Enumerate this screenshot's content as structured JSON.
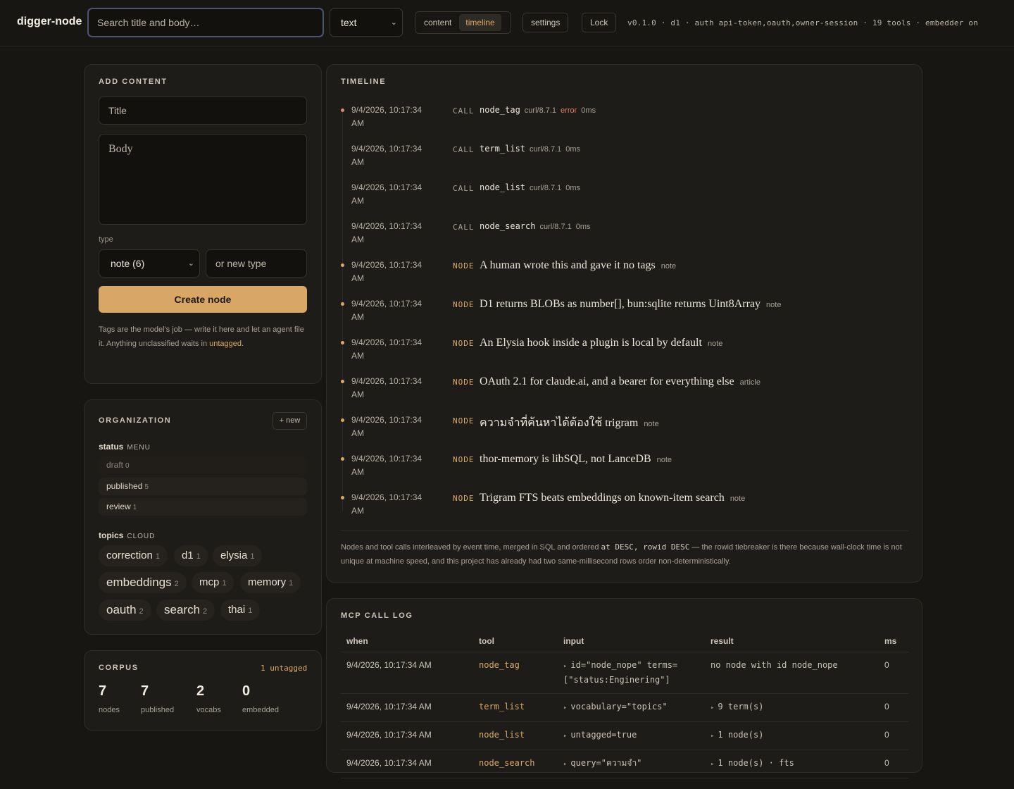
{
  "app": {
    "name": "digger-node",
    "search_placeholder": "Search title and body…",
    "search_mode": "text",
    "view_tabs": [
      "content",
      "timeline"
    ],
    "active_view": "timeline",
    "settings_label": "settings",
    "lock_label": "Lock",
    "meta": "v0.1.0 · d1 · auth api-token,oauth,owner-session · 19 tools · embedder on"
  },
  "add_content": {
    "heading": "ADD CONTENT",
    "title_placeholder": "Title",
    "body_placeholder": "Body",
    "type_label": "type",
    "type_selected": "note (6)",
    "new_type_placeholder": "or new type",
    "create_label": "Create node",
    "hint_text": "Tags are the model's job — write it here and let an agent file it. Anything unclassified waits in ",
    "hint_link": "untagged",
    "hint_end": "."
  },
  "organization": {
    "heading": "ORGANIZATION",
    "new_label": "+ new",
    "status": {
      "name": "status",
      "kind": "MENU",
      "items": [
        {
          "label": "draft",
          "count": "0"
        },
        {
          "label": "published",
          "count": "5"
        },
        {
          "label": "review",
          "count": "1"
        }
      ]
    },
    "topics": {
      "name": "topics",
      "kind": "CLOUD",
      "items": [
        {
          "label": "correction",
          "count": "1"
        },
        {
          "label": "d1",
          "count": "1"
        },
        {
          "label": "elysia",
          "count": "1"
        },
        {
          "label": "embeddings",
          "count": "2"
        },
        {
          "label": "mcp",
          "count": "1"
        },
        {
          "label": "memory",
          "count": "1"
        },
        {
          "label": "oauth",
          "count": "2"
        },
        {
          "label": "search",
          "count": "2"
        },
        {
          "label": "thai",
          "count": "1"
        }
      ]
    }
  },
  "corpus": {
    "heading": "CORPUS",
    "untagged": "1 untagged",
    "stats": [
      {
        "value": "7",
        "label": "nodes"
      },
      {
        "value": "7",
        "label": "published"
      },
      {
        "value": "2",
        "label": "vocabs"
      },
      {
        "value": "0",
        "label": "embedded"
      }
    ]
  },
  "timeline": {
    "heading": "TIMELINE",
    "entries": [
      {
        "time_line1": "9/4/2026, 10:17:34",
        "time_line2": "AM",
        "kind": "CALL",
        "tool": "node_tag",
        "agent": "curl/8.7.1",
        "error": "error",
        "ms": "0ms"
      },
      {
        "time_line1": "9/4/2026, 10:17:34",
        "time_line2": "AM",
        "kind": "CALL",
        "tool": "term_list",
        "agent": "curl/8.7.1",
        "ms": "0ms"
      },
      {
        "time_line1": "9/4/2026, 10:17:34",
        "time_line2": "AM",
        "kind": "CALL",
        "tool": "node_list",
        "agent": "curl/8.7.1",
        "ms": "0ms"
      },
      {
        "time_line1": "9/4/2026, 10:17:34",
        "time_line2": "AM",
        "kind": "CALL",
        "tool": "node_search",
        "agent": "curl/8.7.1",
        "ms": "0ms"
      },
      {
        "time_line1": "9/4/2026, 10:17:34",
        "time_line2": "AM",
        "kind": "NODE",
        "title": "A human wrote this and gave it no tags",
        "type": "note"
      },
      {
        "time_line1": "9/4/2026, 10:17:34",
        "time_line2": "AM",
        "kind": "NODE",
        "title": "D1 returns BLOBs as number[], bun:sqlite returns Uint8Array",
        "type": "note"
      },
      {
        "time_line1": "9/4/2026, 10:17:34",
        "time_line2": "AM",
        "kind": "NODE",
        "title": "An Elysia hook inside a plugin is local by default",
        "type": "note"
      },
      {
        "time_line1": "9/4/2026, 10:17:34",
        "time_line2": "AM",
        "kind": "NODE",
        "title": "OAuth 2.1 for claude.ai, and a bearer for everything else",
        "type": "article"
      },
      {
        "time_line1": "9/4/2026, 10:17:34",
        "time_line2": "AM",
        "kind": "NODE",
        "title": "ความจำที่ค้นหาได้ต้องใช้ trigram",
        "type": "note"
      },
      {
        "time_line1": "9/4/2026, 10:17:34",
        "time_line2": "AM",
        "kind": "NODE",
        "title": "thor-memory is libSQL, not LanceDB",
        "type": "note"
      },
      {
        "time_line1": "9/4/2026, 10:17:34",
        "time_line2": "AM",
        "kind": "NODE",
        "title": "Trigram FTS beats embeddings on known-item search",
        "type": "note"
      }
    ],
    "note_part1": "Nodes and tool calls interleaved by event time, merged in SQL and ordered ",
    "note_code": "at DESC, rowid DESC",
    "note_part2": " — the rowid tiebreaker is there because wall-clock time is not unique at machine speed, and this project has already had two same-millisecond rows order non-deterministically."
  },
  "call_log": {
    "heading": "MCP CALL LOG",
    "columns": [
      "when",
      "tool",
      "input",
      "result",
      "ms"
    ],
    "rows": [
      {
        "when": "9/4/2026, 10:17:34 AM",
        "tool": "node_tag",
        "input": "id=\"node_nope\" terms=[\"status:Enginering\"]",
        "result": "no node with id node_nope",
        "ms": "0",
        "result_expandable": false
      },
      {
        "when": "9/4/2026, 10:17:34 AM",
        "tool": "term_list",
        "input": "vocabulary=\"topics\"",
        "result": "9 term(s)",
        "ms": "0",
        "result_expandable": true
      },
      {
        "when": "9/4/2026, 10:17:34 AM",
        "tool": "node_list",
        "input": "untagged=true",
        "result": "1 node(s)",
        "ms": "0",
        "result_expandable": true
      },
      {
        "when": "9/4/2026, 10:17:34 AM",
        "tool": "node_search",
        "input": "query=\"ความจำ\"",
        "result": "1 node(s) · fts",
        "ms": "0",
        "result_expandable": true
      }
    ]
  },
  "colors": {
    "background": "#181612",
    "card": "#1e1c18",
    "accent": "#d9a967",
    "error": "#e07f5f",
    "primary_button": "#d8a766",
    "search_focus": "#4a5573"
  },
  "icons": {
    "select_chevron": "chevron-down-icon",
    "timeline_marker": "dot-icon",
    "expand": "triangle-right-icon"
  }
}
